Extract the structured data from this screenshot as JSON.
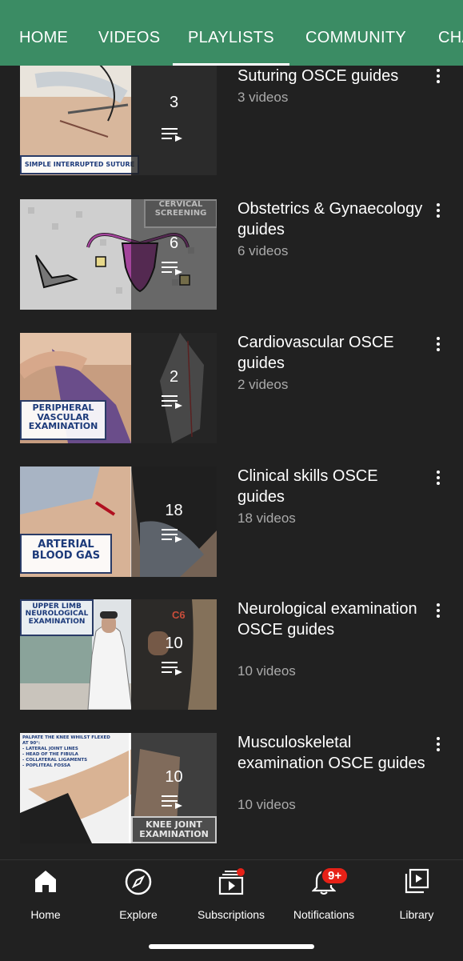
{
  "tabs": [
    {
      "label": "HOME",
      "active": false
    },
    {
      "label": "VIDEOS",
      "active": false
    },
    {
      "label": "PLAYLISTS",
      "active": true
    },
    {
      "label": "COMMUNITY",
      "active": false
    },
    {
      "label": "CHA",
      "active": false
    }
  ],
  "playlists": [
    {
      "title": "Suturing OSCE guides",
      "count": "3",
      "subtitle": "3 videos",
      "thumb_caption": "SIMPLE INTERRUPTED SUTURE"
    },
    {
      "title": "Obstetrics & Gynaecology guides",
      "count": "6",
      "subtitle": "6 videos",
      "thumb_caption": "CERVICAL SCREENING"
    },
    {
      "title": "Cardiovascular OSCE guides",
      "count": "2",
      "subtitle": "2 videos",
      "thumb_caption": "PERIPHERAL VASCULAR EXAMINATION"
    },
    {
      "title": "Clinical skills OSCE guides",
      "count": "18",
      "subtitle": "18 videos",
      "thumb_caption": "ARTERIAL BLOOD GAS"
    },
    {
      "title": "Neurological examination OSCE guides",
      "count": "10",
      "subtitle": "10 videos",
      "thumb_caption": "UPPER LIMB NEUROLOGICAL EXAMINATION",
      "thumb_caption_2": "C6"
    },
    {
      "title": "Musculoskeletal examination OSCE guides",
      "count": "10",
      "subtitle": "10 videos",
      "thumb_caption": "KNEE JOINT EXAMINATION",
      "thumb_text": [
        "PALPATE THE KNEE WHILST FLEXED AT 90°:",
        "- LATERAL JOINT LINES",
        "- HEAD OF THE FIBULA",
        "- COLLATERAL LIGAMENTS",
        "- POPLITEAL FOSSA"
      ]
    }
  ],
  "bottom_nav": [
    {
      "label": "Home",
      "icon": "home-icon"
    },
    {
      "label": "Explore",
      "icon": "compass-icon"
    },
    {
      "label": "Subscriptions",
      "icon": "subscriptions-icon"
    },
    {
      "label": "Notifications",
      "icon": "bell-icon",
      "badge": "9+"
    },
    {
      "label": "Library",
      "icon": "library-icon"
    }
  ],
  "colors": {
    "header": "#3b8c64",
    "background": "#212121",
    "badge": "#e62117",
    "subtitle": "#aaaaaa"
  }
}
